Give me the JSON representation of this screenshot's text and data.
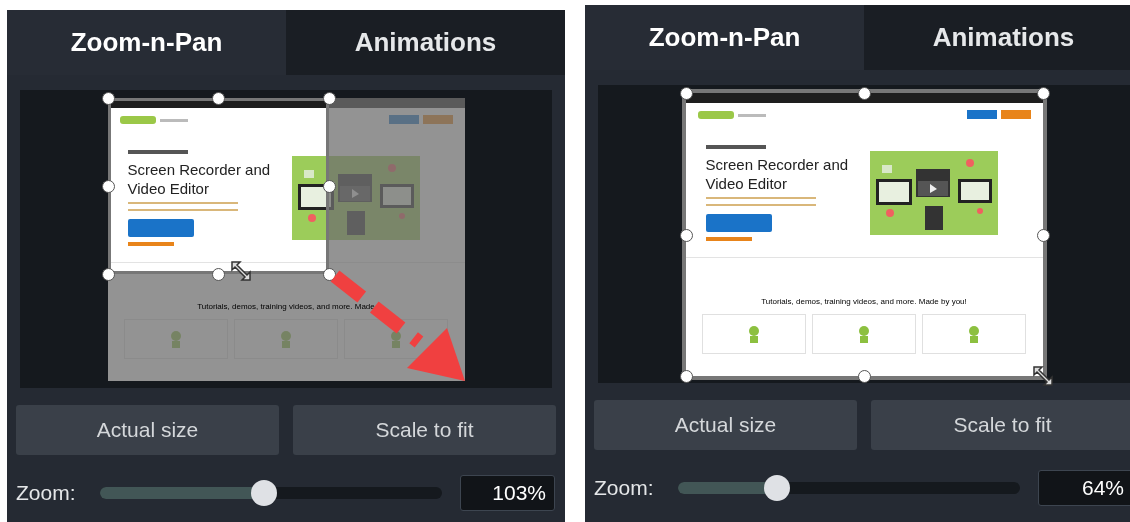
{
  "panels": [
    {
      "tabs": [
        {
          "label": "Zoom-n-Pan",
          "selected": true
        },
        {
          "label": "Animations",
          "selected": false
        }
      ],
      "preview": {
        "full_frame": false,
        "arrow": true,
        "headline": "Screen Recorder and Video Editor",
        "tagline": "Tutorials, demos, training videos, and more. Made"
      },
      "buttons": [
        "Actual size",
        "Scale to fit"
      ],
      "zoom": {
        "label": "Zoom:",
        "level": 0.48,
        "value": "103%"
      }
    },
    {
      "tabs": [
        {
          "label": "Zoom-n-Pan",
          "selected": true
        },
        {
          "label": "Animations",
          "selected": false
        }
      ],
      "preview": {
        "full_frame": true,
        "arrow": false,
        "headline": "Screen Recorder and Video Editor",
        "tagline": "Tutorials, demos, training videos, and more. Made by you!"
      },
      "buttons": [
        "Actual size",
        "Scale to fit"
      ],
      "zoom": {
        "label": "Zoom:",
        "level": 0.29,
        "value": "64%"
      }
    }
  ]
}
